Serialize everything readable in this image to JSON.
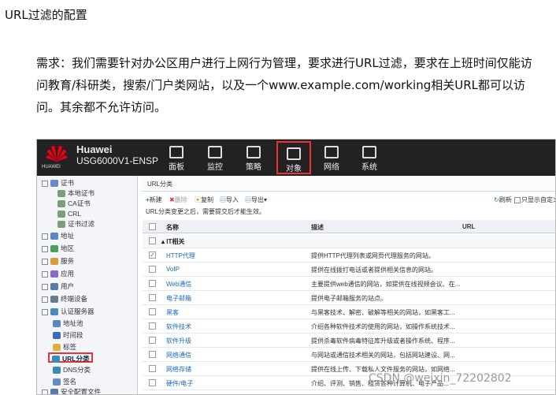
{
  "doc": {
    "title": "URL过滤的配置",
    "requirement": "需求：我们需要针对办公区用户进行上网行为管理，要求进行URL过滤，要求在上班时间仅能访问教育/科研类，搜索/门户类网站，以及一个www.example.com/working相关URL都可以访问。其余都不允许访问。",
    "watermark": "CSDN @weixin_72202802"
  },
  "header": {
    "vendor": "Huawei",
    "model": "USG6000V1-ENSP",
    "logo_text": "HUAWEI",
    "nav": [
      "面板",
      "监控",
      "策略",
      "对象",
      "网络",
      "系统"
    ]
  },
  "sidebar": {
    "items": [
      "证书",
      "本地证书",
      "CA证书",
      "CRL",
      "证书过滤",
      "地址",
      "地区",
      "服务",
      "应用",
      "用户",
      "终端设备",
      "认证服务器",
      "地址池",
      "时间段",
      "标签",
      "URL分类",
      "DNS分类",
      "签名",
      "安全配置文件"
    ]
  },
  "main": {
    "tab": "URL分类",
    "toolbar": {
      "new": "新建",
      "delete": "删除",
      "copy": "复制",
      "import": "导入",
      "export": "导出",
      "refresh": "刷新",
      "only_custom": "只显示自定义"
    },
    "note": "URL分类变更之后，需要提交后才能生效。",
    "columns": [
      "名称",
      "描述",
      "URL"
    ],
    "group": "IT相关",
    "rows": [
      {
        "name": "HTTP代理",
        "desc": "提供HTTP代理列表或网页代理服务的网站。",
        "checked": true
      },
      {
        "name": "VoIP",
        "desc": "提供在线拨打电话或者提供相关信息的网站。",
        "checked": false
      },
      {
        "name": "Web通信",
        "desc": "主要提供web通信的网站，如提供在线视频会议、在...",
        "checked": false
      },
      {
        "name": "电子邮箱",
        "desc": "提供电子邮箱服务的站点。",
        "checked": false
      },
      {
        "name": "黑客",
        "desc": "与黑客技术、解密、破解等相关的网站，如黑客工...",
        "checked": false
      },
      {
        "name": "软件技术",
        "desc": "介绍各种软件技术的使用的网站，如操作系统技术...",
        "checked": false
      },
      {
        "name": "软件升级",
        "desc": "提供杀毒软件病毒特征库升级或者操作系统、程序...",
        "checked": false
      },
      {
        "name": "网络通信",
        "desc": "与网站或通信技术相关的网站，包括网站建设、网...",
        "checked": false
      },
      {
        "name": "网络存储",
        "desc": "提供在线上传、下载私人文件服务的网站，如网络...",
        "checked": false
      },
      {
        "name": "硬件/电子",
        "desc": "介绍、评测、销售、租赁各种计算机、电子产品...",
        "checked": false
      }
    ]
  },
  "colors": {
    "accent": "#e33333",
    "topbar": "#222222",
    "link": "#1a6ac0"
  }
}
